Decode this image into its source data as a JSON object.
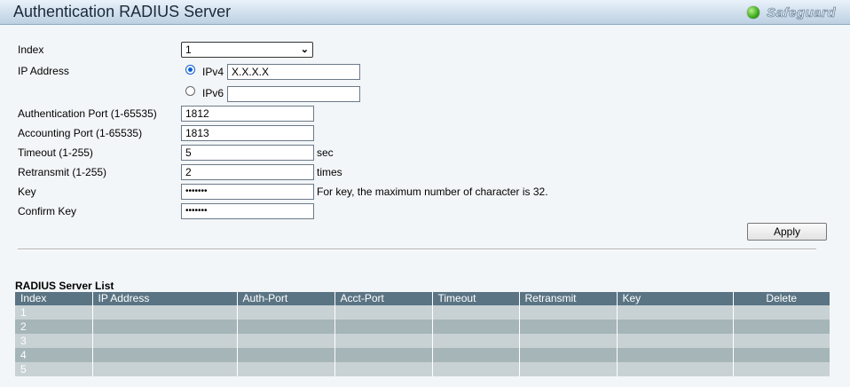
{
  "header": {
    "title": "Authentication RADIUS Server",
    "safeguard_label": "Safeguard"
  },
  "form": {
    "index_label": "Index",
    "index_value": "1",
    "ip_address_label": "IP Address",
    "ipv4_label": "IPv4",
    "ipv4_value": "X.X.X.X",
    "ipv4_selected": true,
    "ipv6_label": "IPv6",
    "ipv6_value": "",
    "auth_port_label": "Authentication Port (1-65535)",
    "auth_port_value": "1812",
    "acct_port_label": "Accounting Port (1-65535)",
    "acct_port_value": "1813",
    "timeout_label": "Timeout (1-255)",
    "timeout_value": "5",
    "timeout_unit": "sec",
    "retransmit_label": "Retransmit (1-255)",
    "retransmit_value": "2",
    "retransmit_unit": "times",
    "key_label": "Key",
    "key_value": "•••••••",
    "key_hint": "For key, the maximum number of character is 32.",
    "confirm_key_label": "Confirm Key",
    "confirm_key_value": "•••••••",
    "apply_label": "Apply"
  },
  "server_list": {
    "title": "RADIUS Server List",
    "columns": [
      "Index",
      "IP Address",
      "Auth-Port",
      "Acct-Port",
      "Timeout",
      "Retransmit",
      "Key",
      "Delete"
    ],
    "rows": [
      {
        "index": "1"
      },
      {
        "index": "2"
      },
      {
        "index": "3"
      },
      {
        "index": "4"
      },
      {
        "index": "5"
      }
    ]
  },
  "colors": {
    "header_bg": "#5a7483",
    "row_light": "#c8d2d4",
    "row_dark": "#a5b5b8",
    "status_green": "#3aa81a"
  },
  "icons": {
    "status": "green-dot-icon",
    "dropdown": "chevron-down-icon"
  }
}
